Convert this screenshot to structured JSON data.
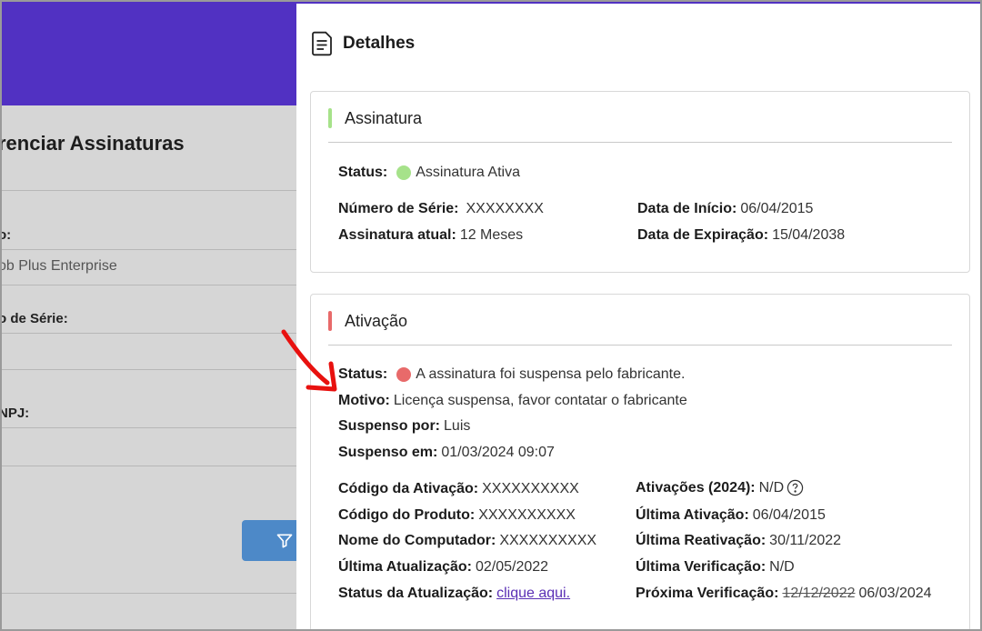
{
  "background": {
    "page_title": "renciar Assinaturas",
    "field1_label": "o:",
    "field1_value": "ob Plus Enterprise",
    "field2_label": "o de Série:",
    "field3_label": "NPJ:"
  },
  "drawer": {
    "title": "Detalhes",
    "assinatura": {
      "title": "Assinatura",
      "status_label": "Status:",
      "status_value": "Assinatura Ativa",
      "serial_label": "Número de Série:",
      "serial_value": "XXXXXXXX",
      "current_label": "Assinatura atual:",
      "current_value": "12 Meses",
      "start_label": "Data de Início:",
      "start_value": "06/04/2015",
      "expiry_label": "Data de Expiração:",
      "expiry_value": "15/04/2038"
    },
    "ativacao": {
      "title": "Ativação",
      "status_label": "Status:",
      "status_value": "A assinatura foi suspensa pelo fabricante.",
      "reason_label": "Motivo:",
      "reason_value": "Licença suspensa, favor contatar o fabricante",
      "suspended_by_label": "Suspenso por:",
      "suspended_by_value": "Luis",
      "suspended_at_label": "Suspenso em:",
      "suspended_at_value": "01/03/2024 09:07",
      "activation_code_label": "Código da Ativação:",
      "activation_code_value": "XXXXXXXXXX",
      "product_code_label": "Código do Produto:",
      "product_code_value": "XXXXXXXXXX",
      "computer_label": "Nome do Computador:",
      "computer_value": "XXXXXXXXXX",
      "last_update_label": "Última Atualização:",
      "last_update_value": "02/05/2022",
      "update_status_label": "Status da Atualização:",
      "update_status_link": "clique aqui.",
      "activations_label": "Ativações (2024):",
      "activations_value": "N/D",
      "last_activation_label": "Última Ativação:",
      "last_activation_value": "06/04/2015",
      "last_reactivation_label": "Última Reativação:",
      "last_reactivation_value": "30/11/2022",
      "last_check_label": "Última Verificação:",
      "last_check_value": "N/D",
      "next_check_label": "Próxima Verificação:",
      "next_check_old": "12/12/2022",
      "next_check_value": "06/03/2024"
    }
  },
  "colors": {
    "brand": "#5131c2",
    "active": "#a6e28a",
    "suspended": "#e86a6a",
    "link": "#5a2fb5",
    "annotation_arrow": "#e8110f"
  },
  "icons": [
    "document-icon",
    "filter-icon",
    "help-circle-icon",
    "annotation-arrow"
  ]
}
